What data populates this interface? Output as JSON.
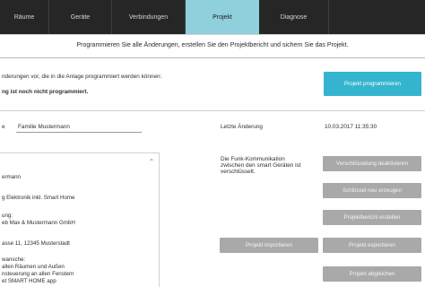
{
  "nav": {
    "tabs": [
      {
        "label": "Räume"
      },
      {
        "label": "Geräte"
      },
      {
        "label": "Verbindungen"
      },
      {
        "label": "Projekt",
        "active": true
      },
      {
        "label": "Diagnose"
      }
    ]
  },
  "instruction": "Programmieren Sie alle Änderungen, erstellen Sie den Projektbericht und sichern Sie das Projekt.",
  "program_section": {
    "info_line": "nderungen vor, die in die Anlage programmiert werden können:",
    "status": "ng ist noch nicht programmiert.",
    "program_button": "Projekt programmieren"
  },
  "project": {
    "name_label": "e",
    "name_value": "Familie Mustermann",
    "last_change_label": "Letzte Änderung",
    "last_change_value": "10.03.2017 11:35:30"
  },
  "radio": {
    "text_line1": "Die Funk-Kommunikation",
    "text_line2": "zwischen den smart Geräten ist",
    "text_line3": "verschlüsselt."
  },
  "buttons": {
    "deactivate_encryption": "Verschlüsselung deaktivieren",
    "reset_key": "Schlüssel neu erzeugen",
    "create_report": "Projektbericht erstellen",
    "import_project": "Projekt importieren",
    "export_project": "Projekt exportieren",
    "complete_project": "Projekt abgleichen"
  },
  "details": {
    "line1": "ermann",
    "line2": "g Elektronik inkl. Smart Home",
    "line3": "ung:",
    "line4": "eb Max & Mustermann GmbH",
    "line5": "asse 11, 12345 Musterstadt",
    "line6": "wansche:",
    "line7": "allen Räumen und Außen",
    "line8": "nsteuerung an allen Fenstern",
    "line9": "et SMART HOME app"
  }
}
